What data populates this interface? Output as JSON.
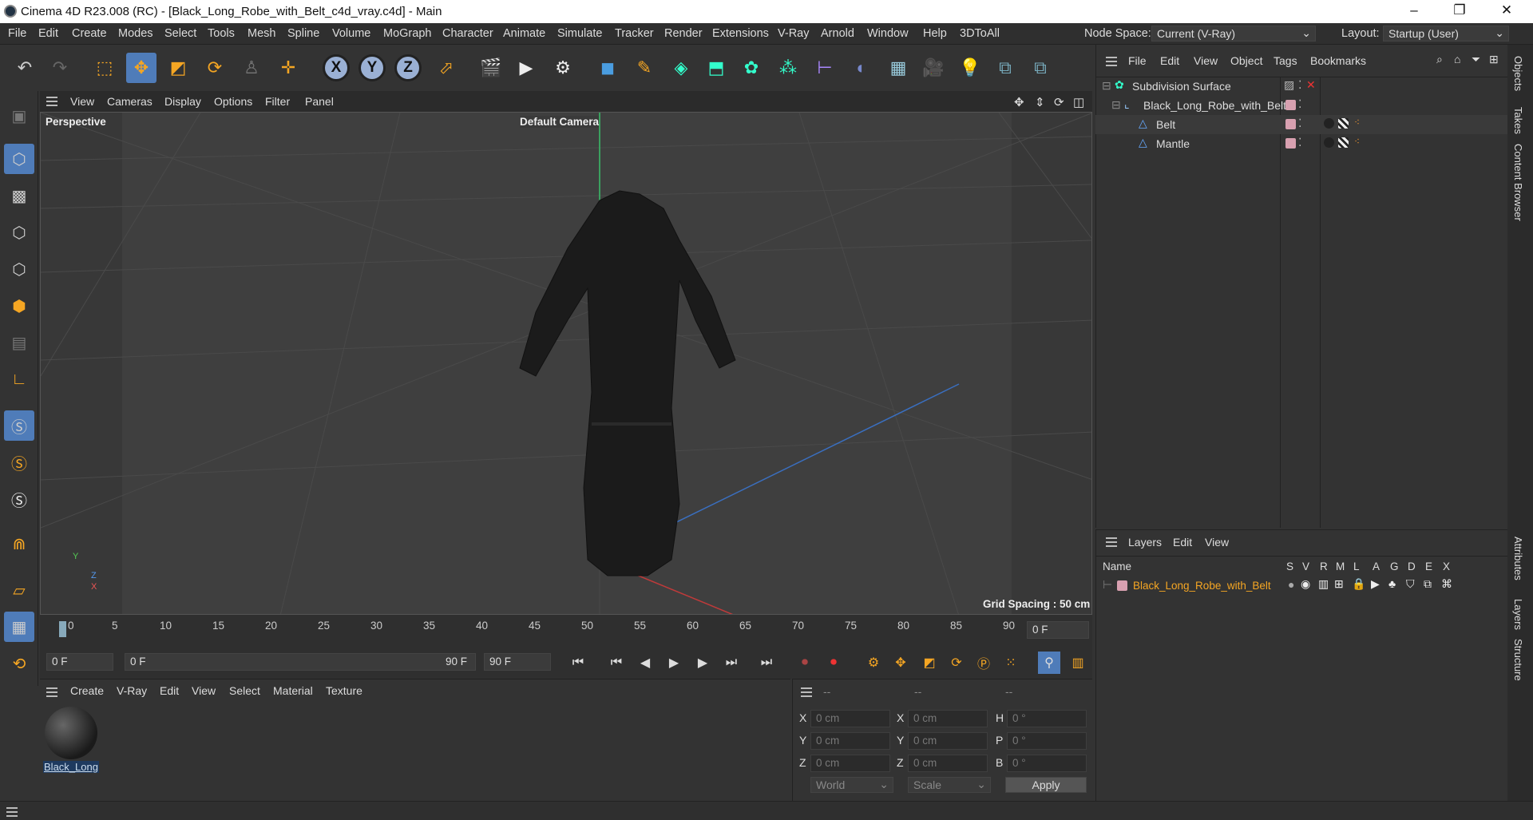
{
  "window": {
    "title": "Cinema 4D R23.008 (RC) - [Black_Long_Robe_with_Belt_c4d_vray.c4d] - Main"
  },
  "menu": [
    "File",
    "Edit",
    "Create",
    "Modes",
    "Select",
    "Tools",
    "Mesh",
    "Spline",
    "Volume",
    "MoGraph",
    "Character",
    "Animate",
    "Simulate",
    "Tracker",
    "Render",
    "Extensions",
    "V-Ray",
    "Arnold",
    "Window",
    "Help",
    "3DToAll"
  ],
  "node_space": {
    "label": "Node Space:",
    "value": "Current (V-Ray)"
  },
  "layout": {
    "label": "Layout:",
    "value": "Startup (User)"
  },
  "viewport": {
    "menu": [
      "View",
      "Cameras",
      "Display",
      "Options",
      "Filter",
      "Panel"
    ],
    "name": "Perspective",
    "camera": "Default Camera",
    "grid_spacing": "Grid Spacing : 50 cm"
  },
  "timeline": {
    "ticks": [
      "0",
      "5",
      "10",
      "15",
      "20",
      "25",
      "30",
      "35",
      "40",
      "45",
      "50",
      "55",
      "60",
      "65",
      "70",
      "75",
      "80",
      "85",
      "90"
    ],
    "current_frame": "0 F"
  },
  "transport": {
    "start": "0 F",
    "range_start": "0 F",
    "range_end": "90 F",
    "end": "90 F"
  },
  "material_panel": {
    "menu": [
      "Create",
      "V-Ray",
      "Edit",
      "View",
      "Select",
      "Material",
      "Texture"
    ],
    "material_name": "Black_Long"
  },
  "coords": {
    "headers": [
      "--",
      "--",
      "--"
    ],
    "rows": [
      {
        "a": "X",
        "av": "0 cm",
        "b": "X",
        "bv": "0 cm",
        "c": "H",
        "cv": "0 °"
      },
      {
        "a": "Y",
        "av": "0 cm",
        "b": "Y",
        "bv": "0 cm",
        "c": "P",
        "cv": "0 °"
      },
      {
        "a": "Z",
        "av": "0 cm",
        "b": "Z",
        "bv": "0 cm",
        "c": "B",
        "cv": "0 °"
      }
    ],
    "world": "World",
    "scale": "Scale",
    "apply": "Apply"
  },
  "objects_panel": {
    "menu": [
      "File",
      "Edit",
      "View",
      "Object",
      "Tags",
      "Bookmarks"
    ],
    "items": [
      "Subdivision Surface",
      "Black_Long_Robe_with_Belt",
      "Belt",
      "Mantle"
    ]
  },
  "layers_panel": {
    "menu": [
      "Layers",
      "Edit",
      "View"
    ],
    "name_col": "Name",
    "cols": [
      "S",
      "V",
      "R",
      "M",
      "L",
      "A",
      "G",
      "D",
      "E",
      "X"
    ],
    "layer": "Black_Long_Robe_with_Belt"
  },
  "side_tabs": [
    "Objects",
    "Takes",
    "Content Browser",
    "Attributes",
    "Layers",
    "Structure"
  ],
  "colors": {
    "accent": "#4f7cb9",
    "layer_text": "#f5a623",
    "orange_icon": "#f5a623"
  }
}
